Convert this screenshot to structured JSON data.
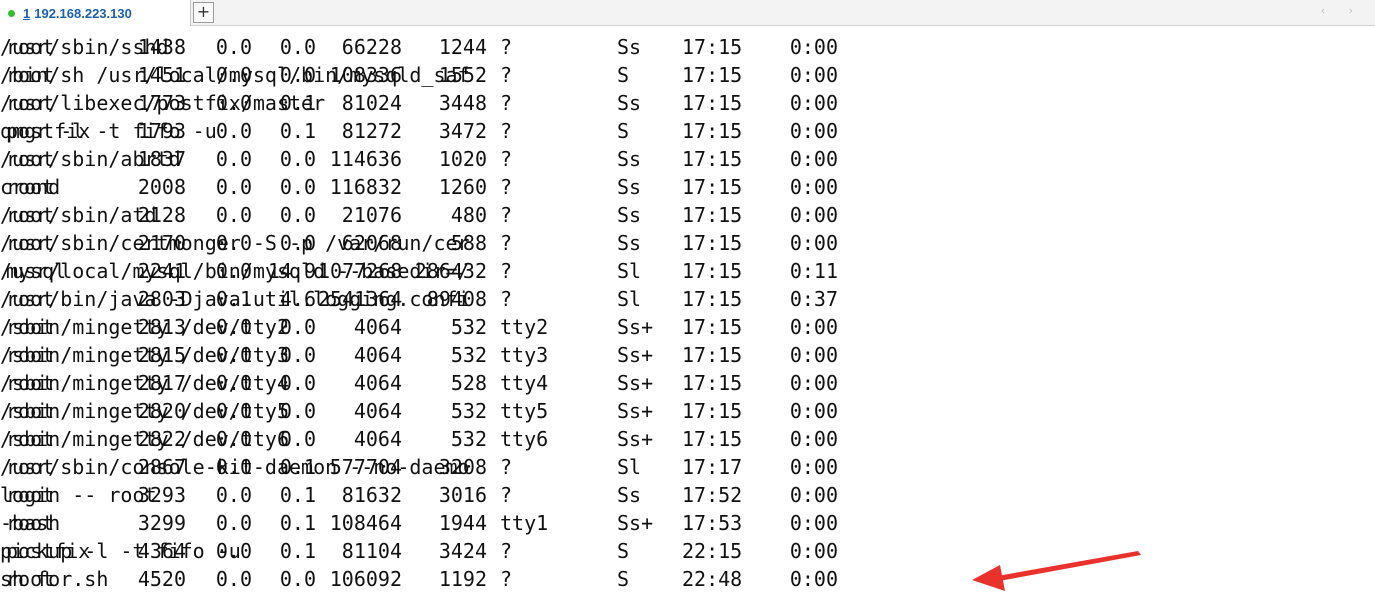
{
  "tab": {
    "number": "1",
    "title": "192.168.223.130"
  },
  "new_tab_label": "+",
  "nav_arrows": "‹ ›",
  "colors": {
    "status_dot": "#2ec02e",
    "arrow": "#e8322b"
  },
  "process_rows": [
    {
      "user": "root",
      "pid": "1438",
      "cpu": "0.0",
      "mem": "0.0",
      "vsz": "66228",
      "rss": "1244",
      "tty": "?",
      "stat": "Ss",
      "start": "17:15",
      "time": "0:00",
      "command": "/usr/sbin/sshd"
    },
    {
      "user": "root",
      "pid": "1451",
      "cpu": "0.0",
      "mem": "0.0",
      "vsz": "108336",
      "rss": "1552",
      "tty": "?",
      "stat": "S",
      "start": "17:15",
      "time": "0:00",
      "command": "/bin/sh /usr/local/mysql/bin/mysqld_saf"
    },
    {
      "user": "root",
      "pid": "1773",
      "cpu": "0.0",
      "mem": "0.1",
      "vsz": "81024",
      "rss": "3448",
      "tty": "?",
      "stat": "Ss",
      "start": "17:15",
      "time": "0:00",
      "command": "/usr/libexec/postfix/master"
    },
    {
      "user": "postfix",
      "pid": "1793",
      "cpu": "0.0",
      "mem": "0.1",
      "vsz": "81272",
      "rss": "3472",
      "tty": "?",
      "stat": "S",
      "start": "17:15",
      "time": "0:00",
      "command": "qmgr -l -t fifo -u"
    },
    {
      "user": "root",
      "pid": "1837",
      "cpu": "0.0",
      "mem": "0.0",
      "vsz": "114636",
      "rss": "1020",
      "tty": "?",
      "stat": "Ss",
      "start": "17:15",
      "time": "0:00",
      "command": "/usr/sbin/abrtd"
    },
    {
      "user": "root",
      "pid": "2008",
      "cpu": "0.0",
      "mem": "0.0",
      "vsz": "116832",
      "rss": "1260",
      "tty": "?",
      "stat": "Ss",
      "start": "17:15",
      "time": "0:00",
      "command": "crond"
    },
    {
      "user": "root",
      "pid": "2128",
      "cpu": "0.0",
      "mem": "0.0",
      "vsz": "21076",
      "rss": "480",
      "tty": "?",
      "stat": "Ss",
      "start": "17:15",
      "time": "0:00",
      "command": "/usr/sbin/atd"
    },
    {
      "user": "root",
      "pid": "2170",
      "cpu": "0.0",
      "mem": "0.0",
      "vsz": "62068",
      "rss": "588",
      "tty": "?",
      "stat": "Ss",
      "start": "17:15",
      "time": "0:00",
      "command": "/usr/sbin/certmonger -S -p /var/run/cer"
    },
    {
      "user": "mysql",
      "pid": "2241",
      "cpu": "0.0",
      "mem": "14.9",
      "vsz": "1077268",
      "rss": "286432",
      "tty": "?",
      "stat": "Sl",
      "start": "17:15",
      "time": "0:11",
      "command": "/usr/local/mysql/bin/mysqld --basedir=/"
    },
    {
      "user": "root",
      "pid": "2803",
      "cpu": "0.1",
      "mem": "4.6",
      "vsz": "2541364",
      "rss": "89408",
      "tty": "?",
      "stat": "Sl",
      "start": "17:15",
      "time": "0:37",
      "command": "/usr/bin/java -Djava.util.logging.confi"
    },
    {
      "user": "root",
      "pid": "2813",
      "cpu": "0.0",
      "mem": "0.0",
      "vsz": "4064",
      "rss": "532",
      "tty": "tty2",
      "stat": "Ss+",
      "start": "17:15",
      "time": "0:00",
      "command": "/sbin/mingetty /dev/tty2"
    },
    {
      "user": "root",
      "pid": "2815",
      "cpu": "0.0",
      "mem": "0.0",
      "vsz": "4064",
      "rss": "532",
      "tty": "tty3",
      "stat": "Ss+",
      "start": "17:15",
      "time": "0:00",
      "command": "/sbin/mingetty /dev/tty3"
    },
    {
      "user": "root",
      "pid": "2817",
      "cpu": "0.0",
      "mem": "0.0",
      "vsz": "4064",
      "rss": "528",
      "tty": "tty4",
      "stat": "Ss+",
      "start": "17:15",
      "time": "0:00",
      "command": "/sbin/mingetty /dev/tty4"
    },
    {
      "user": "root",
      "pid": "2820",
      "cpu": "0.0",
      "mem": "0.0",
      "vsz": "4064",
      "rss": "532",
      "tty": "tty5",
      "stat": "Ss+",
      "start": "17:15",
      "time": "0:00",
      "command": "/sbin/mingetty /dev/tty5"
    },
    {
      "user": "root",
      "pid": "2822",
      "cpu": "0.0",
      "mem": "0.0",
      "vsz": "4064",
      "rss": "532",
      "tty": "tty6",
      "stat": "Ss+",
      "start": "17:15",
      "time": "0:00",
      "command": "/sbin/mingetty /dev/tty6"
    },
    {
      "user": "root",
      "pid": "2867",
      "cpu": "0.0",
      "mem": "0.1",
      "vsz": "577704",
      "rss": "3208",
      "tty": "?",
      "stat": "Sl",
      "start": "17:17",
      "time": "0:00",
      "command": "/usr/sbin/console-kit-daemon --no-daemo"
    },
    {
      "user": "root",
      "pid": "3293",
      "cpu": "0.0",
      "mem": "0.1",
      "vsz": "81632",
      "rss": "3016",
      "tty": "?",
      "stat": "Ss",
      "start": "17:52",
      "time": "0:00",
      "command": "login -- root"
    },
    {
      "user": "root",
      "pid": "3299",
      "cpu": "0.0",
      "mem": "0.1",
      "vsz": "108464",
      "rss": "1944",
      "tty": "tty1",
      "stat": "Ss+",
      "start": "17:53",
      "time": "0:00",
      "command": "-bash"
    },
    {
      "user": "postfix",
      "pid": "4364",
      "cpu": "0.0",
      "mem": "0.1",
      "vsz": "81104",
      "rss": "3424",
      "tty": "?",
      "stat": "S",
      "start": "22:15",
      "time": "0:00",
      "command": "pickup -l -t fifo -u"
    },
    {
      "user": "root",
      "pid": "4520",
      "cpu": "0.0",
      "mem": "0.0",
      "vsz": "106092",
      "rss": "1192",
      "tty": "?",
      "stat": "S",
      "start": "22:48",
      "time": "0:00",
      "command": "sh for.sh"
    }
  ]
}
